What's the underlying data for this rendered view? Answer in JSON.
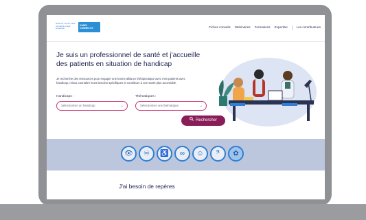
{
  "header": {
    "logo_text": "Soutenir, former, faire connaître et agir ensemble",
    "logo_badge": "HANDI CONNECT.fr",
    "nav": [
      "Fiches conseils",
      "Webinaires",
      "Formations",
      "Expertise",
      "Les contributeurs"
    ]
  },
  "hero": {
    "title": "Je suis un professionnel de santé et j'accueille des patients en situation de handicap",
    "description": "Je recherche des ressources pour engager une bonne alliance thérapeutique avec mes patients avec handicap, mieux connaître leurs besoins spécifiques et contribuer à une santé plus accessible.",
    "handicap_label": "Handicaps :",
    "handicap_placeholder": "Sélectionner un handicap",
    "thematique_label": "Thématiques :",
    "thematique_placeholder": "Sélectionner une thématique",
    "search_label": "Rechercher"
  },
  "categories": [
    {
      "icon": "visual-impairment-icon",
      "glyph": "👁"
    },
    {
      "icon": "autism-icon",
      "glyph": "♾"
    },
    {
      "icon": "wheelchair-icon",
      "glyph": "♿"
    },
    {
      "icon": "polyhandicap-icon",
      "glyph": "∞"
    },
    {
      "icon": "mental-health-icon",
      "glyph": "☺"
    },
    {
      "icon": "hearing-impairment-icon",
      "glyph": "𝄢"
    },
    {
      "icon": "rare-disease-icon",
      "glyph": "✿"
    }
  ],
  "section": {
    "title": "J'ai besoin de repères"
  },
  "colors": {
    "primary": "#8a1d58",
    "accent": "#2f7fd2",
    "band": "#bcc6dc"
  }
}
